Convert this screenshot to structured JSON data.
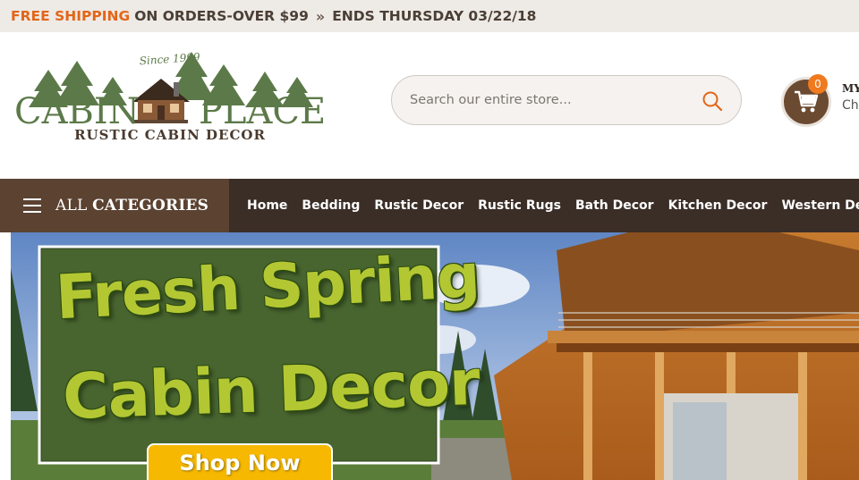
{
  "promo": {
    "highlight": "FREE SHIPPING",
    "text": "ON ORDERS-OVER $99",
    "separator": "»",
    "ends": "ENDS THURSDAY 03/22/18"
  },
  "logo": {
    "since": "Since 1999",
    "name_left": "CABIN",
    "name_right": "PLACE",
    "tagline": "RUSTIC CABIN DECOR"
  },
  "search": {
    "placeholder": "Search our entire store..."
  },
  "cart": {
    "count": "0",
    "title": "MY",
    "subtitle": "Che"
  },
  "nav": {
    "all_prefix": "ALL",
    "all_label": "CATEGORIES",
    "items": [
      "Home",
      "Bedding",
      "Rustic Decor",
      "Rustic Rugs",
      "Bath Decor",
      "Kitchen Decor",
      "Western Decor"
    ]
  },
  "hero": {
    "line1": "Fresh Spring",
    "line2": "Cabin Decor",
    "button": "Shop Now"
  },
  "colors": {
    "accent": "#e2661a",
    "nav_bg": "#3a2e27",
    "allcat_bg": "#5b4231",
    "cart_bg": "#6b4a32",
    "badge": "#f07a1e",
    "logo_green": "#5c7a49",
    "hero_text": "#b3c733",
    "button": "#f6b800"
  }
}
